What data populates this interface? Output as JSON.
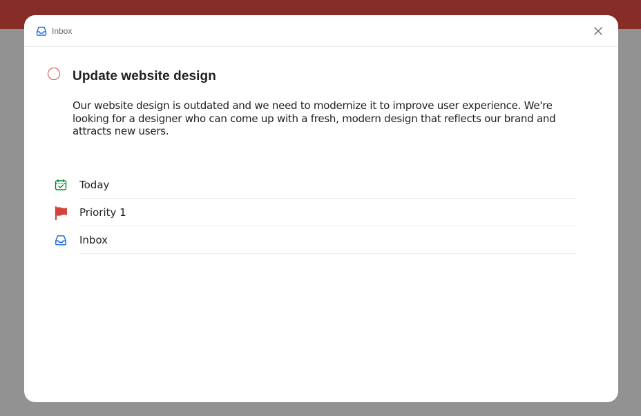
{
  "header": {
    "breadcrumb_label": "Inbox",
    "breadcrumb_icon": "inbox-icon",
    "close_icon": "close-icon"
  },
  "task": {
    "title": "Update website design",
    "description": "Our website design is outdated and we need to modernize it to improve user experience. We're looking for a designer who can come up with a fresh, modern design that reflects our brand and attracts new users.",
    "completed": false
  },
  "attributes": [
    {
      "label": "Today",
      "icon": "calendar-today-icon",
      "color": "#058527"
    },
    {
      "label": "Priority 1",
      "icon": "flag-icon",
      "color": "#d1453b"
    },
    {
      "label": "Inbox",
      "icon": "inbox-icon",
      "color": "#246fe0"
    }
  ],
  "colors": {
    "accent": "#d1453b",
    "topbar": "#862d27",
    "overlay": "#929292"
  }
}
